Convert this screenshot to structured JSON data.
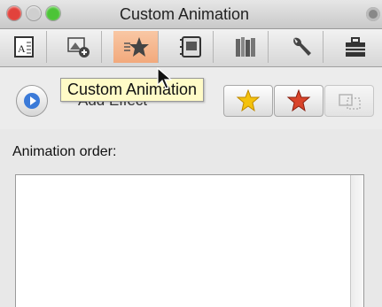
{
  "window": {
    "title": "Custom Animation",
    "traffic_lights": {
      "close": "#e2423c",
      "minimize": "#c9c9c9",
      "zoom": "#4cc437"
    }
  },
  "toolbar": {
    "items": [
      {
        "name": "text-inspector",
        "icon": "text-box-icon"
      },
      {
        "name": "picture-inspector",
        "icon": "picture-add-icon"
      },
      {
        "name": "custom-animation",
        "icon": "star-animation-icon",
        "active": true
      },
      {
        "name": "slide-inspector",
        "icon": "slide-icon"
      },
      {
        "name": "object-palette",
        "icon": "books-icon"
      },
      {
        "name": "tools",
        "icon": "wrench-icon"
      },
      {
        "name": "toolbox",
        "icon": "briefcase-icon"
      }
    ]
  },
  "effects": {
    "add_effect_label": "Add Effect",
    "buttons": [
      {
        "name": "entrance-effect",
        "icon": "star-yellow-icon"
      },
      {
        "name": "emphasis-effect",
        "icon": "star-red-icon"
      },
      {
        "name": "motion-path",
        "icon": "motion-path-icon",
        "disabled": true
      }
    ]
  },
  "tooltip": {
    "text": "Custom Animation"
  },
  "animation_order": {
    "label": "Animation order:",
    "items": []
  },
  "colors": {
    "active_tool": "#f2a97c",
    "tooltip_bg": "#fffbc7"
  }
}
